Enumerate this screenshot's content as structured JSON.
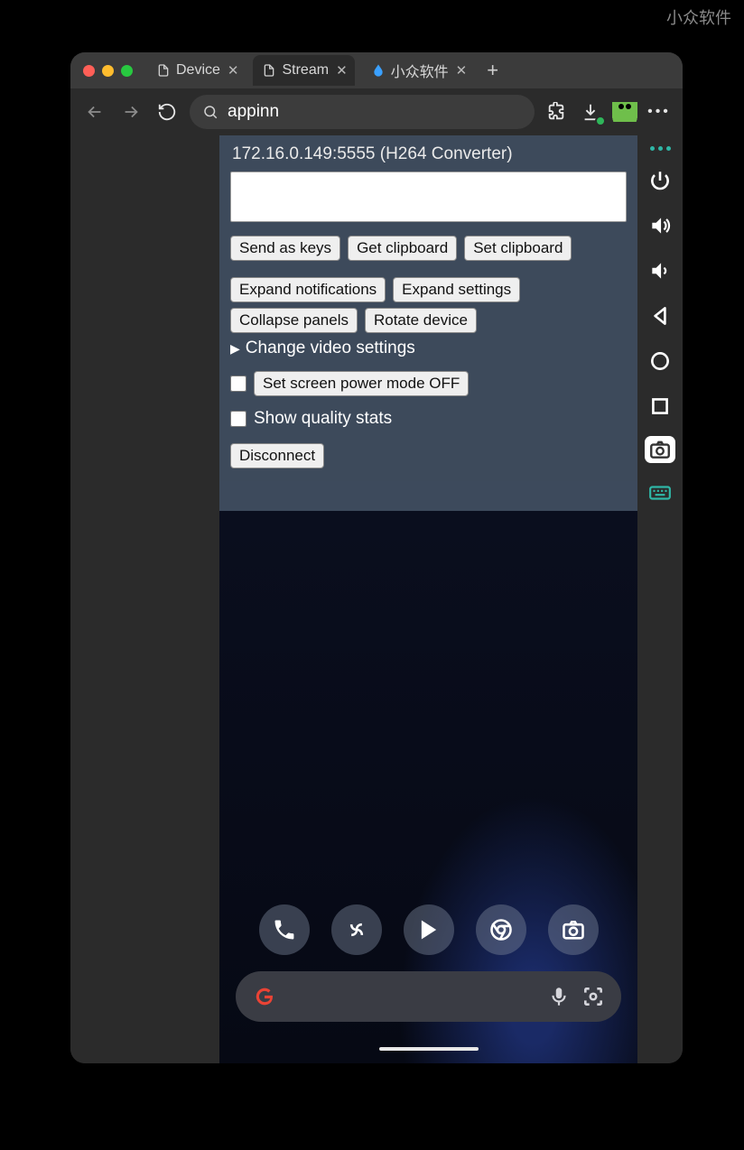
{
  "watermark": "小众软件",
  "tabs": [
    {
      "label": "Device",
      "active": false
    },
    {
      "label": "Stream",
      "active": true
    },
    {
      "label": "小众软件",
      "active": false
    }
  ],
  "search": {
    "value": "appinn"
  },
  "panel": {
    "title": "172.16.0.149:5555 (H264 Converter)",
    "textarea_value": "",
    "send_as_keys": "Send as keys",
    "get_clipboard": "Get clipboard",
    "set_clipboard": "Set clipboard",
    "expand_notifications": "Expand notifications",
    "expand_settings": "Expand settings",
    "collapse_panels": "Collapse panels",
    "rotate_device": "Rotate device",
    "change_video_settings": "Change video settings",
    "set_screen_power_off": "Set screen power mode OFF",
    "show_quality_stats": "Show quality stats",
    "disconnect": "Disconnect"
  },
  "sidebar_icons": [
    "menu-dots",
    "power",
    "volume-up",
    "volume-down",
    "back",
    "home",
    "square",
    "camera",
    "keyboard"
  ],
  "dock_icons": [
    "phone",
    "fan",
    "play-store",
    "chrome",
    "camera"
  ]
}
